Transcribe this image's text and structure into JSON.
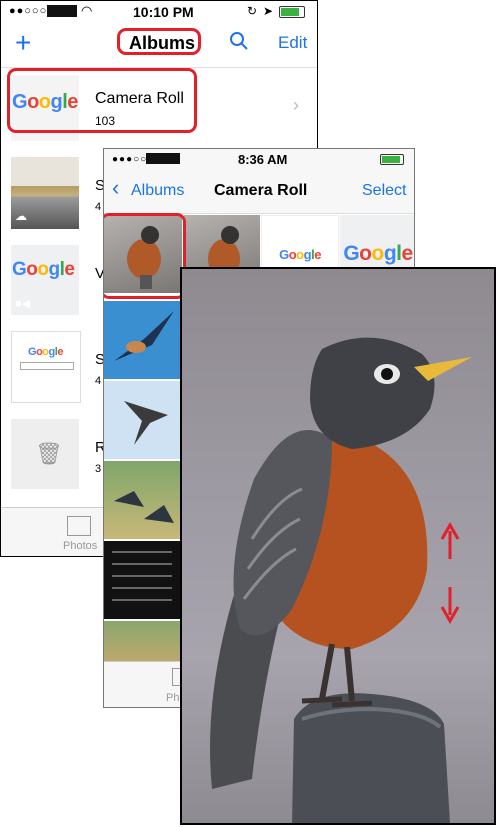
{
  "back_screen": {
    "status": {
      "time": "10:10 PM"
    },
    "nav": {
      "add_label": "+",
      "title": "Albums",
      "edit_label": "Edit"
    },
    "albums": [
      {
        "name": "Camera Roll",
        "count": "103"
      },
      {
        "name": "S",
        "count": "4"
      },
      {
        "name": "V",
        "count": ""
      },
      {
        "name": "S",
        "count": "4"
      },
      {
        "name": "R",
        "count": "3"
      }
    ],
    "tabbar": {
      "photos_label": "Photos"
    }
  },
  "middle_screen": {
    "status": {
      "time": "8:36 AM"
    },
    "nav": {
      "back_label": "Albums",
      "title": "Camera Roll",
      "select_label": "Select"
    },
    "tabbar": {
      "photos_label": "Pho"
    }
  },
  "google_text": "Google",
  "colors": {
    "accent": "#1a73e8",
    "highlight": "#e2202a"
  }
}
